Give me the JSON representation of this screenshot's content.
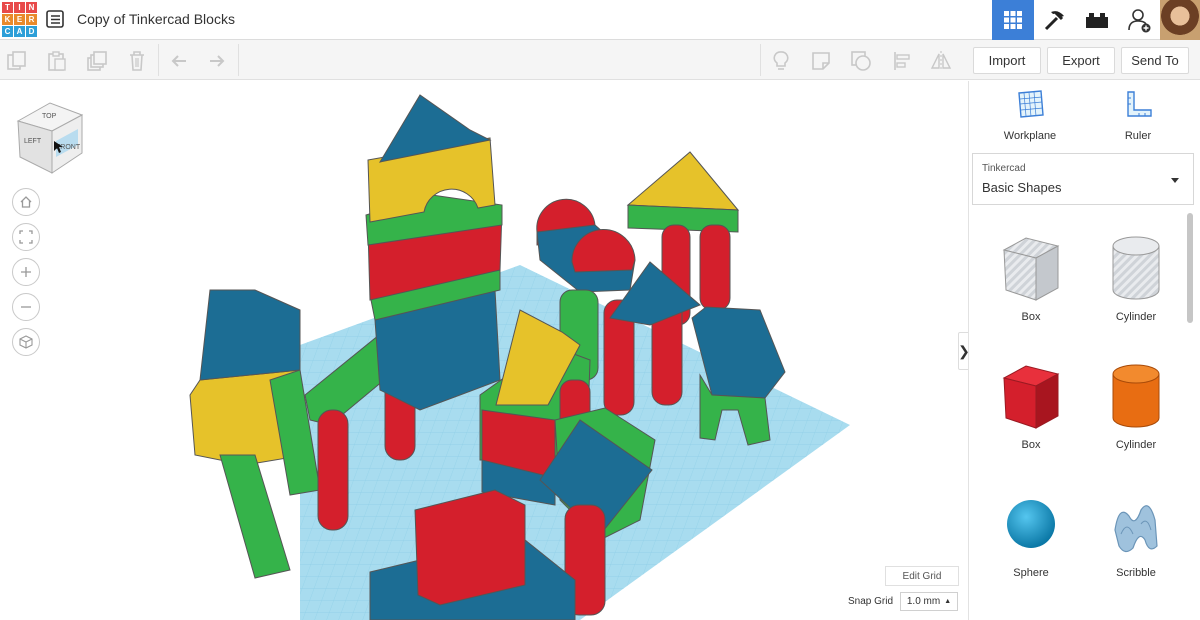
{
  "app": {
    "logo_letters": [
      "T",
      "I",
      "N",
      "K",
      "E",
      "R",
      "C",
      "A",
      "D"
    ],
    "logo_colors": [
      "#e84a4a",
      "#e84a4a",
      "#e84a4a",
      "#e98a2c",
      "#e98a2c",
      "#e98a2c",
      "#2d9fd8",
      "#2d9fd8",
      "#2d9fd8"
    ],
    "document_title": "Copy of Tinkercad Blocks"
  },
  "header_icons": [
    "grid-view-icon",
    "pickaxe-icon",
    "bricks-icon",
    "add-user-icon"
  ],
  "toolbar": {
    "left_icons": [
      "copy-icon",
      "paste-icon",
      "duplicate-icon",
      "delete-icon",
      "undo-icon",
      "redo-icon"
    ],
    "right_icons": [
      "lightbulb-icon",
      "note-icon",
      "group-shape-icon",
      "align-icon",
      "mirror-icon"
    ],
    "import_label": "Import",
    "export_label": "Export",
    "send_to_label": "Send To"
  },
  "view_cube": {
    "top": "TOP",
    "left": "LEFT",
    "front": "FRONT"
  },
  "nav_buttons": [
    "home-icon",
    "fit-view-icon",
    "zoom-in-icon",
    "zoom-out-icon",
    "perspective-icon"
  ],
  "sidebar": {
    "workplane_label": "Workplane",
    "ruler_label": "Ruler",
    "category_small": "Tinkercad",
    "category_value": "Basic Shapes",
    "shapes": [
      {
        "label": "Box",
        "icon": "box-hole-icon"
      },
      {
        "label": "Cylinder",
        "icon": "cylinder-hole-icon"
      },
      {
        "label": "Box",
        "icon": "box-solid-icon"
      },
      {
        "label": "Cylinder",
        "icon": "cylinder-solid-icon"
      },
      {
        "label": "Sphere",
        "icon": "sphere-icon"
      },
      {
        "label": "Scribble",
        "icon": "scribble-icon"
      }
    ]
  },
  "grid": {
    "edit_grid_label": "Edit Grid",
    "snap_grid_label": "Snap Grid",
    "snap_value": "1.0 mm"
  },
  "colors": {
    "accent": "#3c7fd7",
    "block_red": "#d41f2c",
    "block_blue": "#1c6d94",
    "block_green": "#35b34a",
    "block_yellow": "#e6c22a",
    "workplane": "#a8dcef"
  }
}
